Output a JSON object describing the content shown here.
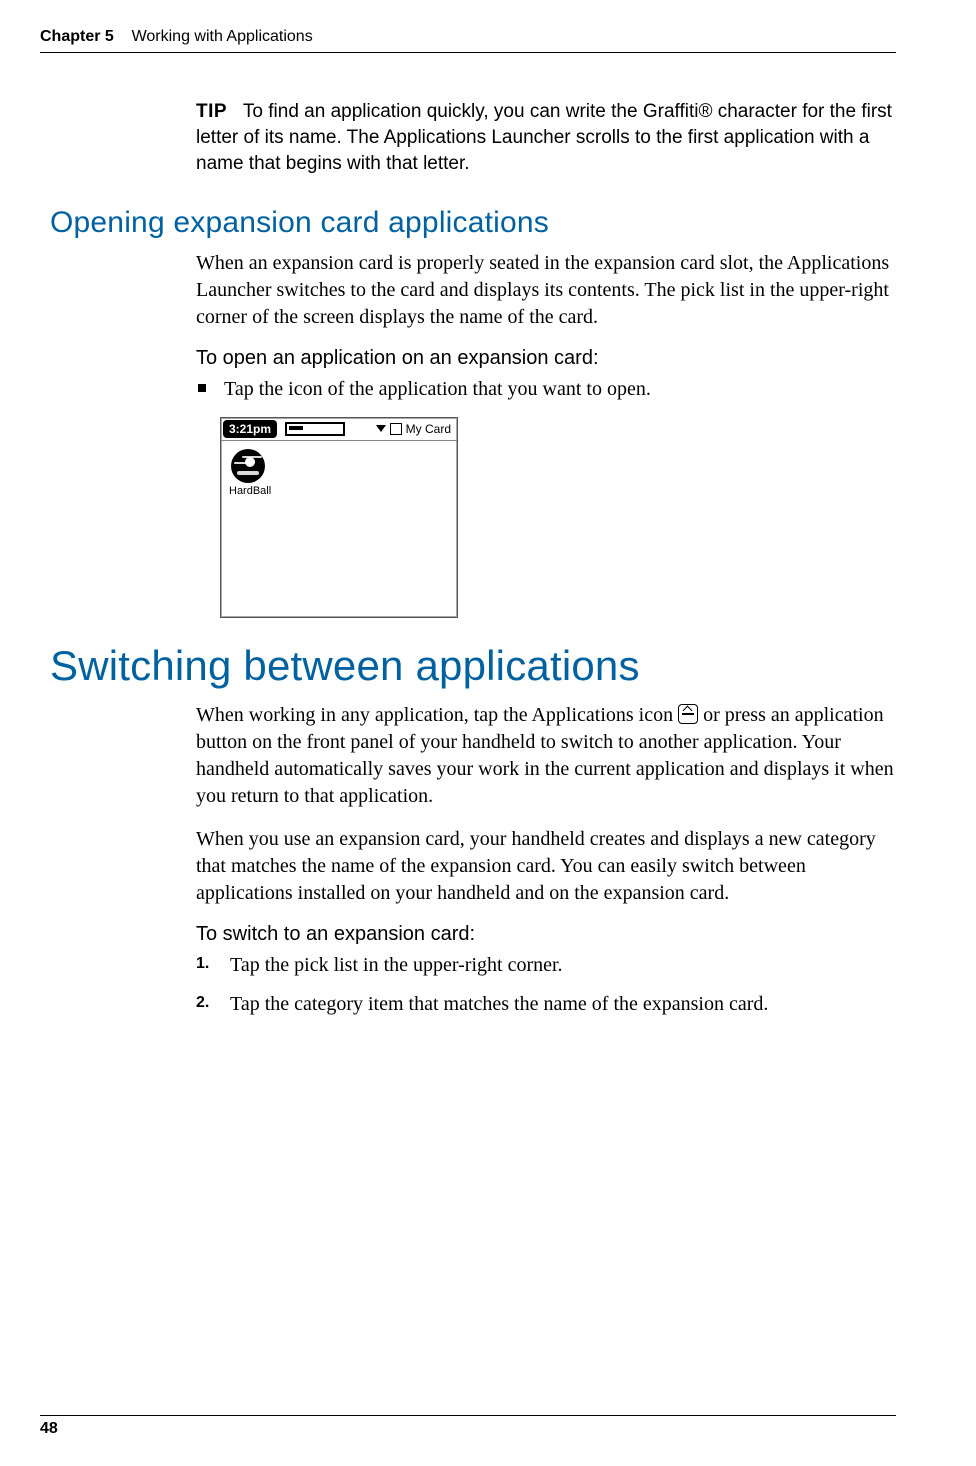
{
  "header": {
    "chapter": "Chapter 5",
    "title": "Working with Applications"
  },
  "tip": {
    "label": "TIP",
    "text": "To find an application quickly, you can write the Graffiti® character for the first letter of its name. The Applications Launcher scrolls to the first application with a name that begins with that letter."
  },
  "section1": {
    "heading": "Opening expansion card applications",
    "para": "When an expansion card is properly seated in the expansion card slot, the Applications Launcher switches to the card and displays its contents. The pick list in the upper-right corner of the screen displays the name of the card.",
    "runin": "To open an application on an expansion card:",
    "bullet": "Tap the icon of the application that you want to open."
  },
  "screenshot": {
    "time": "3:21pm",
    "picklist": "My Card",
    "app_name": "HardBall"
  },
  "section2": {
    "heading": "Switching between applications",
    "para1a": "When working in any application, tap the Applications icon ",
    "para1b": " or press an application button on the front panel of your handheld to switch to another application. Your handheld automatically saves your work in the current application and displays it when you return to that application.",
    "para2": "When you use an expansion card, your handheld creates and displays a new category that matches the name of the expansion card. You can easily switch between applications installed on your handheld and on the expansion card.",
    "runin": "To switch to an expansion card:",
    "steps": [
      "Tap the pick list in the upper-right corner.",
      "Tap the category item that matches the name of the expansion card."
    ]
  },
  "page_number": "48"
}
